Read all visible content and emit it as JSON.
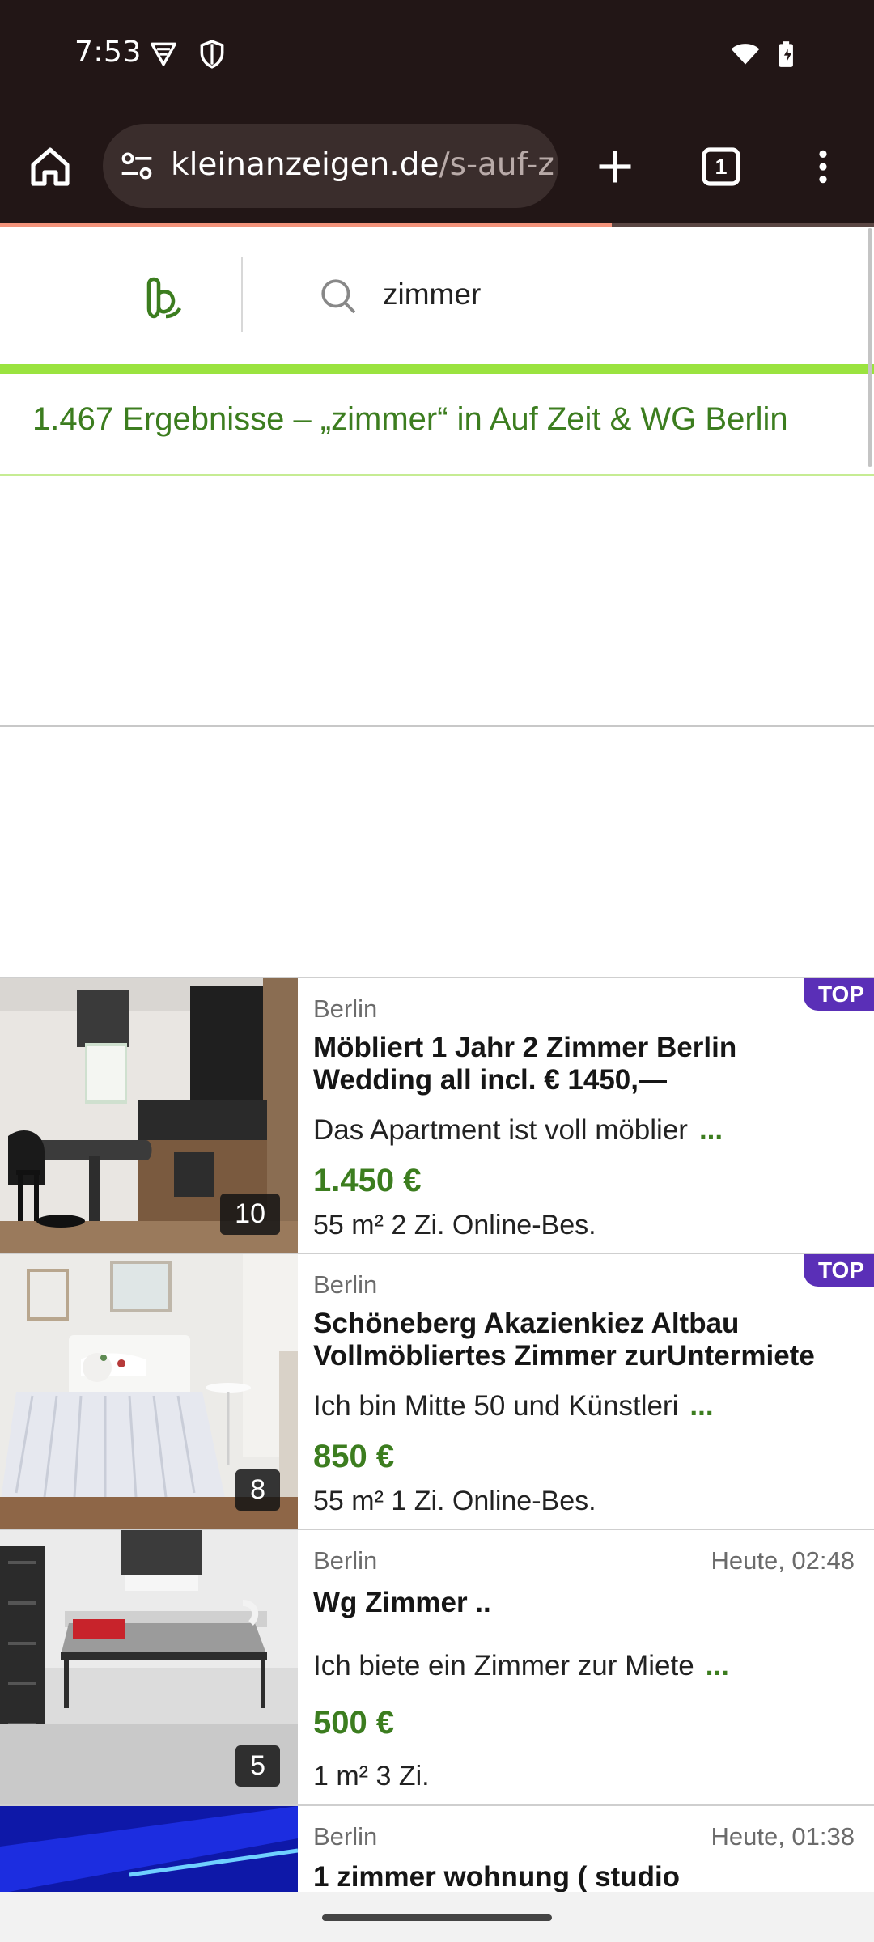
{
  "status_bar": {
    "time": "7:53",
    "icons": [
      "vpn-icon",
      "shield-icon",
      "wifi-icon",
      "battery-icon"
    ]
  },
  "browser": {
    "url_domain": "kleinanzeigen.de",
    "url_path": "/s-auf-z",
    "tab_count": "1",
    "icons": [
      "home-icon",
      "site-settings-icon",
      "new-tab-icon",
      "tab-switcher-icon",
      "menu-icon"
    ],
    "progress_fraction": 0.7
  },
  "site": {
    "search_query": "zimmer",
    "results_text": "1.467 Ergebnisse – „zimmer“ in Auf Zeit & WG Berlin",
    "accent_color": "#3c7d1f",
    "bar_color": "#9ae33f",
    "top_badge_color": "#5a2fb7"
  },
  "listings": [
    {
      "location": "Berlin",
      "badge": "TOP",
      "date": "",
      "title": "Möbliert 1 Jahr 2 Zimmer Berlin Wedding all incl. € 1450,—",
      "description": "Das Apartment ist voll möblier",
      "more": "...",
      "price": "1.450 €",
      "attributes": "55 m² 2 Zi. Online-Bes.",
      "photo_count": "10"
    },
    {
      "location": "Berlin",
      "badge": "TOP",
      "date": "",
      "title": "Schöneberg Akazienkiez Altbau Vollmöbliertes Zimmer zurUntermiete",
      "description": "Ich bin Mitte 50 und Künstleri",
      "more": "...",
      "price": "850 €",
      "attributes": "55 m² 1 Zi. Online-Bes.",
      "photo_count": "8"
    },
    {
      "location": "Berlin",
      "badge": "",
      "date": "Heute, 02:48",
      "title": "Wg Zimmer ..",
      "description": "Ich biete ein Zimmer zur Miete",
      "more": "...",
      "price": "500 €",
      "attributes": "1 m² 3 Zi.",
      "photo_count": "5"
    },
    {
      "location": "Berlin",
      "badge": "",
      "date": "Heute, 01:38",
      "title": "1 zimmer wohnung ( studio",
      "description": "",
      "more": "",
      "price": "",
      "attributes": "",
      "photo_count": ""
    }
  ]
}
